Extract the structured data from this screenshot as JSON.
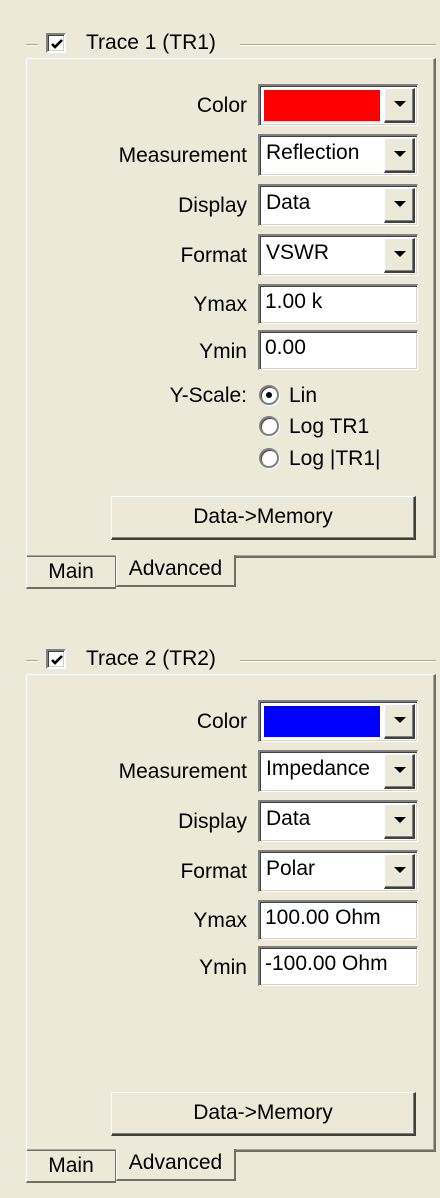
{
  "trace1": {
    "title": "Trace 1 (TR1)",
    "enabled": true,
    "color_label": "Color",
    "color_value": "#ff0000",
    "measurement_label": "Measurement",
    "measurement_value": "Reflection",
    "display_label": "Display",
    "display_value": "Data",
    "format_label": "Format",
    "format_value": "VSWR",
    "ymax_label": "Ymax",
    "ymax_value": "1.00 k",
    "ymin_label": "Ymin",
    "ymin_value": "0.00",
    "yscale_label": "Y-Scale:",
    "yscale_options": [
      "Lin",
      "Log TR1",
      "Log |TR1|"
    ],
    "yscale_selected": "Lin",
    "data_memory_label": "Data->Memory",
    "tabs": [
      "Main",
      "Advanced"
    ],
    "active_tab": "Main"
  },
  "trace2": {
    "title": "Trace 2 (TR2)",
    "enabled": true,
    "color_label": "Color",
    "color_value": "#0000ff",
    "measurement_label": "Measurement",
    "measurement_value": "Impedance",
    "display_label": "Display",
    "display_value": "Data",
    "format_label": "Format",
    "format_value": "Polar",
    "ymax_label": "Ymax",
    "ymax_value": "100.00 Ohm",
    "ymin_label": "Ymin",
    "ymin_value": "-100.00 Ohm",
    "data_memory_label": "Data->Memory",
    "tabs": [
      "Main",
      "Advanced"
    ],
    "active_tab": "Main"
  }
}
